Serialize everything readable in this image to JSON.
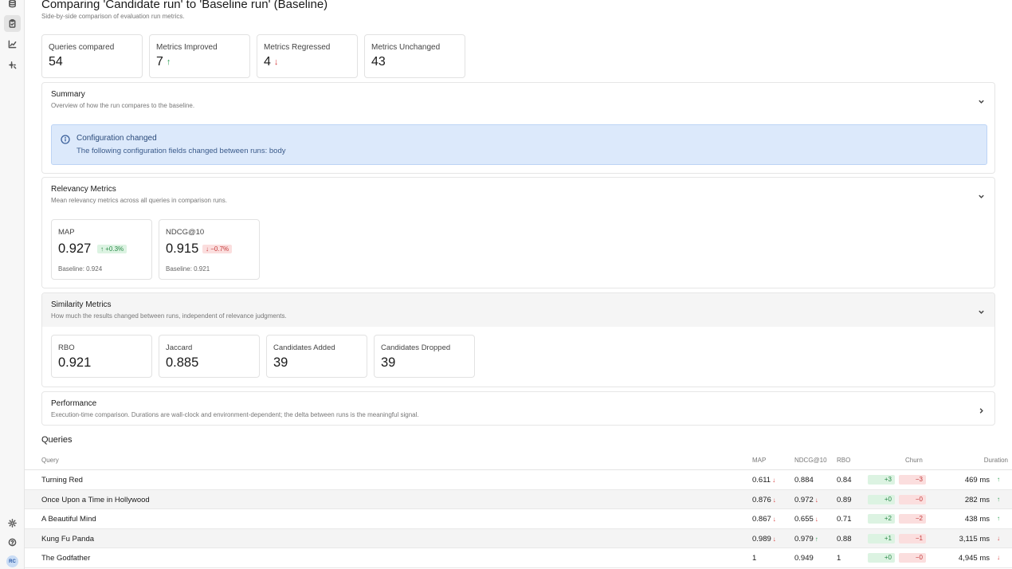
{
  "sidebar": {
    "icons": [
      "database-icon",
      "clipboard-icon",
      "chart-icon",
      "sparkle-icon"
    ],
    "bottom_icons": [
      "settings-icon",
      "help-icon"
    ],
    "avatar": "RC"
  },
  "header": {
    "title": "Comparing 'Candidate run' to 'Baseline run' (Baseline)",
    "subtitle": "Side-by-side comparison of evaluation run metrics."
  },
  "stats": [
    {
      "label": "Queries compared",
      "value": "54",
      "trend": ""
    },
    {
      "label": "Metrics Improved",
      "value": "7",
      "trend": "↑"
    },
    {
      "label": "Metrics Regressed",
      "value": "4",
      "trend": "↓"
    },
    {
      "label": "Metrics Unchanged",
      "value": "43",
      "trend": ""
    }
  ],
  "summary": {
    "title": "Summary",
    "description": "Overview of how the run compares to the baseline.",
    "alert_title": "Configuration changed",
    "alert_text": "The following configuration fields changed between runs: body"
  },
  "relevancy": {
    "title": "Relevancy Metrics",
    "description": "Mean relevancy metrics across all queries in comparison runs.",
    "metrics": [
      {
        "label": "MAP",
        "value": "0.927",
        "delta": "↑ +0.3%",
        "baseline": "Baseline:  0.924"
      },
      {
        "label": "NDCG@10",
        "value": "0.915",
        "delta": "↓ −0.7%",
        "baseline": "Baseline:  0.921"
      }
    ]
  },
  "similarity": {
    "title": "Similarity Metrics",
    "description": "How much the results changed between runs, independent of relevance judgments.",
    "metrics": [
      {
        "label": "RBO",
        "value": "0.921"
      },
      {
        "label": "Jaccard",
        "value": "0.885"
      },
      {
        "label": "Candidates Added",
        "value": "39"
      },
      {
        "label": "Candidates Dropped",
        "value": "39"
      }
    ]
  },
  "performance": {
    "title": "Performance",
    "description": "Execution-time comparison. Durations are wall-clock and environment-dependent; the delta between runs is the meaningful signal."
  },
  "queries": {
    "title": "Queries",
    "columns": {
      "query": "Query",
      "map": "MAP",
      "ndcg": "NDCG@10",
      "rbo": "RBO",
      "churn": "Churn",
      "duration": "Duration"
    },
    "rows": [
      {
        "query": "Turning Red",
        "map": "0.611",
        "map_arrow": "↓",
        "ndcg": "0.884",
        "ndcg_arrow": "",
        "rbo": "0.84",
        "added": "+3",
        "dropped": "−3",
        "duration": "469 ms",
        "dur_arrow": "↑"
      },
      {
        "query": "Once Upon a Time in Hollywood",
        "map": "0.876",
        "map_arrow": "↓",
        "ndcg": "0.972",
        "ndcg_arrow": "↓",
        "rbo": "0.89",
        "added": "+0",
        "dropped": "−0",
        "duration": "282 ms",
        "dur_arrow": "↑"
      },
      {
        "query": "A Beautiful Mind",
        "map": "0.867",
        "map_arrow": "↓",
        "ndcg": "0.655",
        "ndcg_arrow": "↓",
        "rbo": "0.71",
        "added": "+2",
        "dropped": "−2",
        "duration": "438 ms",
        "dur_arrow": "↑"
      },
      {
        "query": "Kung Fu Panda",
        "map": "0.989",
        "map_arrow": "↓",
        "ndcg": "0.979",
        "ndcg_arrow": "↑",
        "rbo": "0.88",
        "added": "+1",
        "dropped": "−1",
        "duration": "3,115 ms",
        "dur_arrow": "↓"
      },
      {
        "query": "The Godfather",
        "map": "1",
        "map_arrow": "",
        "ndcg": "0.949",
        "ndcg_arrow": "",
        "rbo": "1",
        "added": "+0",
        "dropped": "−0",
        "duration": "4,945 ms",
        "dur_arrow": "↓"
      }
    ]
  },
  "colors": {
    "up": "#2e9e53",
    "down": "#d43d3d",
    "alert_bg": "#dce9fb"
  }
}
